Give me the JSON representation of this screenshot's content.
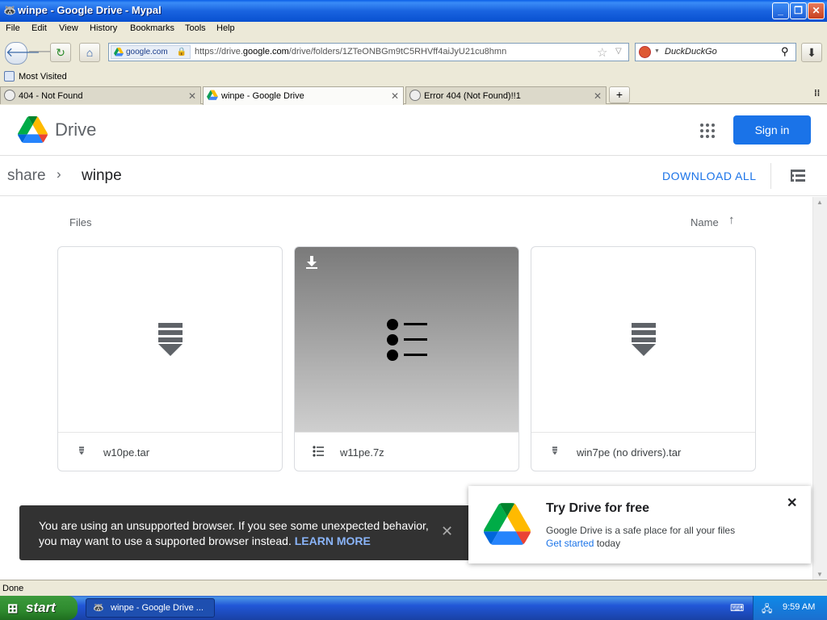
{
  "window": {
    "title": "winpe - Google Drive - Mypal",
    "min_symbol": "_",
    "restore_symbol": "❐",
    "close_symbol": "✕"
  },
  "menu": [
    "File",
    "Edit",
    "View",
    "History",
    "Bookmarks",
    "Tools",
    "Help"
  ],
  "nav": {
    "site_identity": "google.com",
    "url_prefix": "https://drive.",
    "url_domain": "google.com",
    "url_path": "/drive/folders/1ZTeONBGm9tC5RHVff4aiJyU21cu8hmn",
    "search_placeholder": "DuckDuckGo"
  },
  "bookmarks": {
    "most_visited": "Most Visited"
  },
  "tabs": [
    {
      "label": "404 - Not Found",
      "active": false
    },
    {
      "label": "winpe - Google Drive",
      "active": true
    },
    {
      "label": "Error 404 (Not Found)!!1",
      "active": false
    }
  ],
  "drive": {
    "brand": "Drive",
    "signin_label": "Sign in",
    "breadcrumb": [
      "share",
      "winpe"
    ],
    "download_all": "DOWNLOAD ALL",
    "files_label": "Files",
    "sort_label": "Name",
    "files": [
      {
        "name": "w10pe.tar",
        "icon": "archive-icon"
      },
      {
        "name": "w11pe.7z",
        "icon": "list-icon"
      },
      {
        "name": "win7pe (no drivers).tar",
        "icon": "archive-icon"
      }
    ]
  },
  "toast": {
    "message": "You are using an unsupported browser. If you see some unexpected behavior, you may want to use a supported browser instead.",
    "link": "LEARN MORE"
  },
  "promo": {
    "title": "Try Drive for free",
    "body": "Google Drive is a safe place for all your files",
    "cta": "Get started",
    "cta_suffix": "today"
  },
  "status": {
    "text": "Done"
  },
  "taskbar": {
    "start": "start",
    "task": "winpe - Google Drive ...",
    "clock": "9:59 AM"
  },
  "colors": {
    "brand_blue": "#1a73e8",
    "toast_bg": "#323232"
  }
}
